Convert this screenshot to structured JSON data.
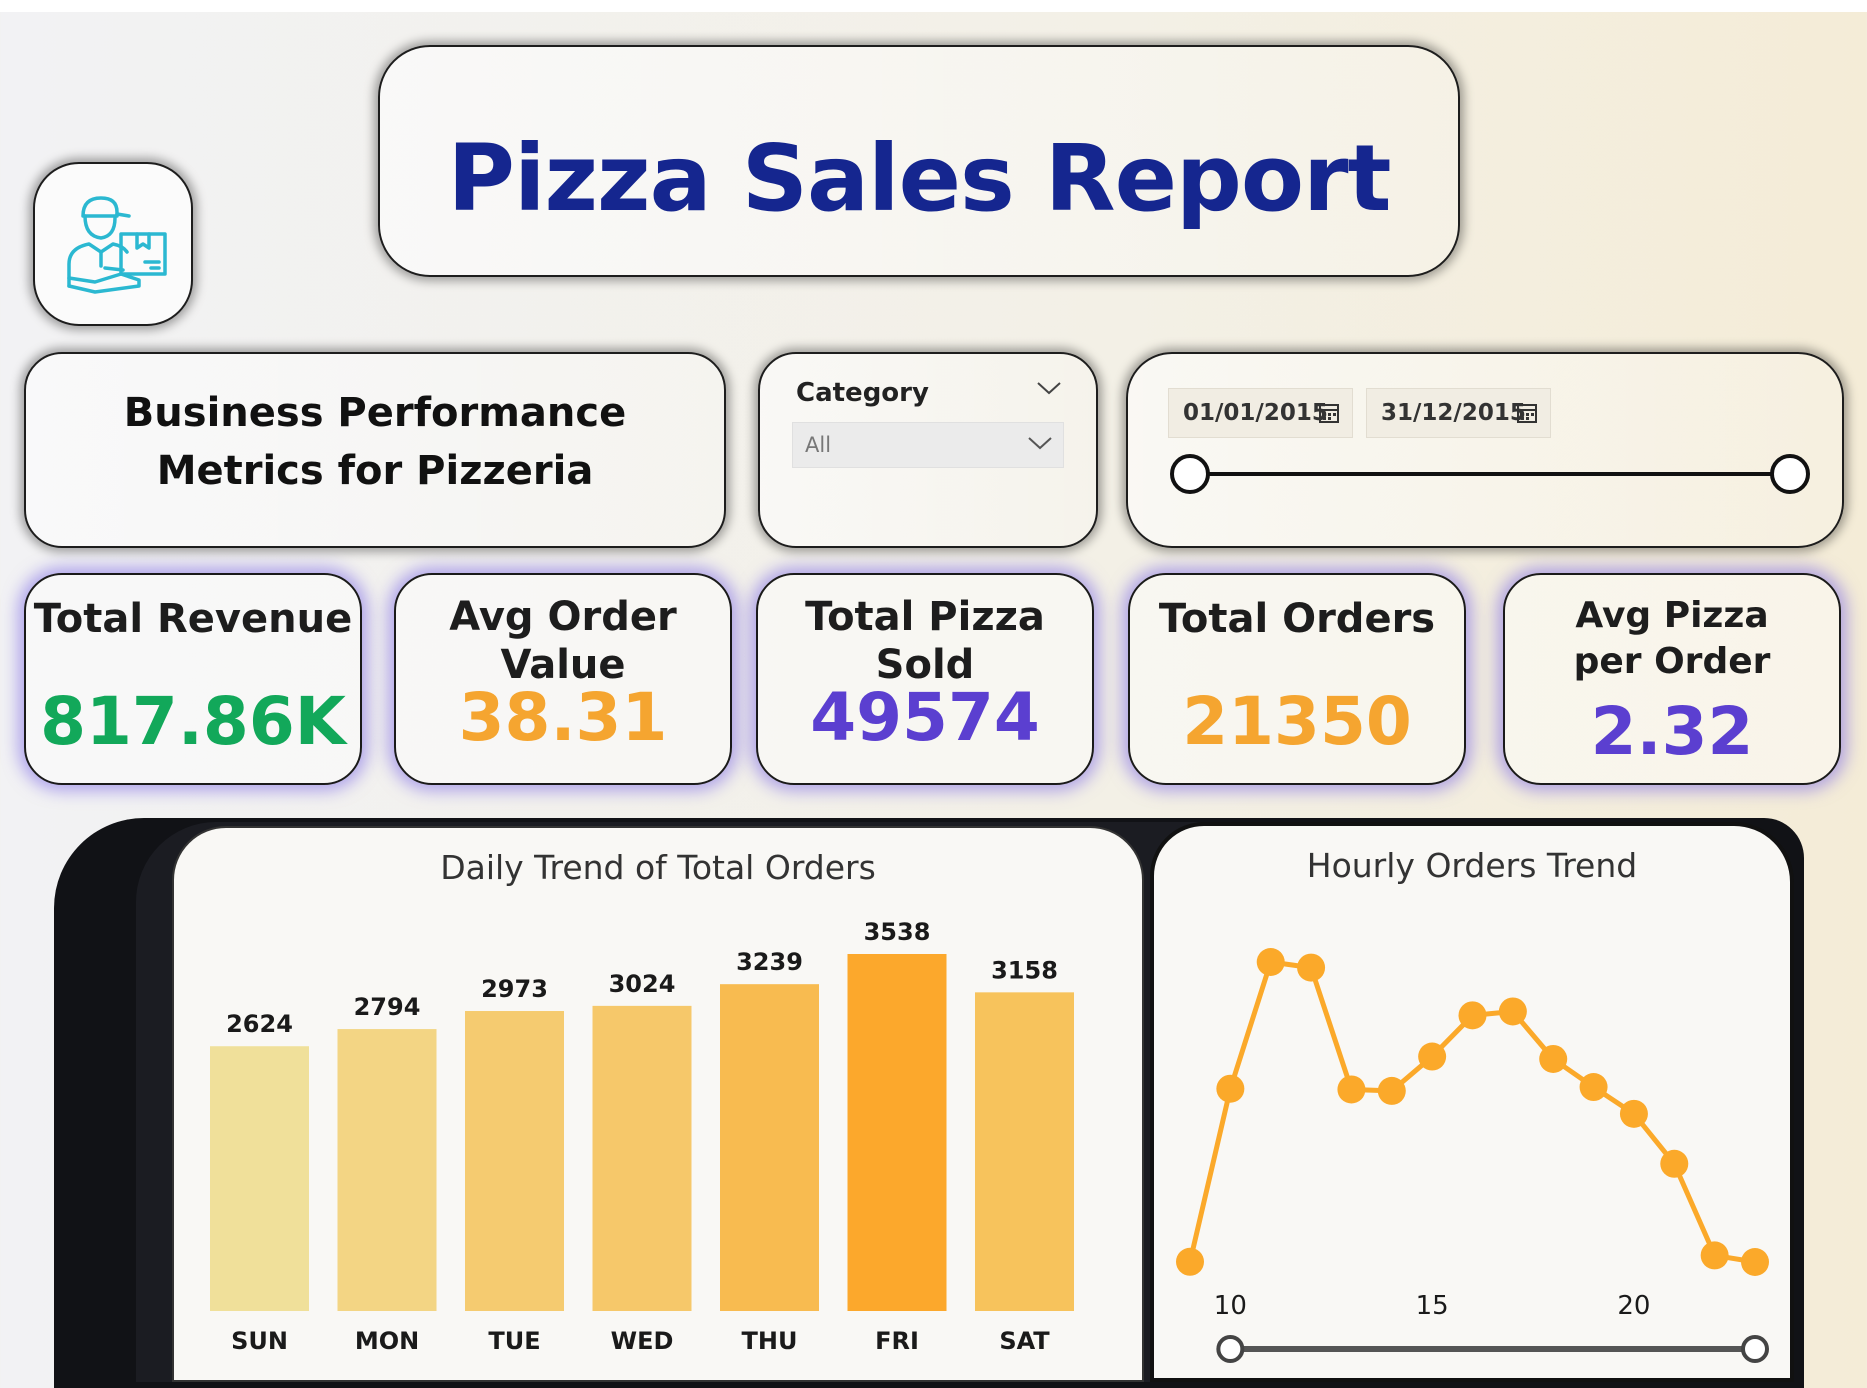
{
  "title": "Pizza Sales Report",
  "subtitle": "Business Performance Metrics for Pizzeria",
  "filters": {
    "category_label": "Category",
    "category_value": "All",
    "date_start": "01/01/2015",
    "date_end": "31/12/2015"
  },
  "kpis": [
    {
      "title": "Total Revenue",
      "value": "817.86K",
      "color": "#12a85a"
    },
    {
      "title": "Avg Order Value",
      "value": "38.31",
      "color": "#f5a530"
    },
    {
      "title": "Total Pizza Sold",
      "value": "49574",
      "color": "#5b3fd0"
    },
    {
      "title": "Total Orders",
      "value": "21350",
      "color": "#f5a530"
    },
    {
      "title": "Avg Pizza per Order",
      "value": "2.32",
      "color": "#5b3fd0"
    }
  ],
  "chart_data": [
    {
      "type": "bar",
      "title": "Daily Trend of Total Orders",
      "categories": [
        "SUN",
        "MON",
        "TUE",
        "WED",
        "THU",
        "FRI",
        "SAT"
      ],
      "values": [
        2624,
        2794,
        2973,
        3024,
        3239,
        3538,
        3158
      ],
      "colors": [
        "#f0e09a",
        "#f3d584",
        "#f5cb70",
        "#f6c86a",
        "#f8bb50",
        "#fca82c",
        "#f7c35c"
      ],
      "data_labels": true,
      "ylim": [
        0,
        3538
      ]
    },
    {
      "type": "line",
      "title": "Hourly Orders Trend",
      "x": [
        9,
        10,
        11,
        12,
        13,
        14,
        15,
        16,
        17,
        18,
        19,
        20,
        21,
        22,
        23
      ],
      "values": [
        1,
        711,
        1231,
        1208,
        708,
        702,
        843,
        1012,
        1028,
        833,
        718,
        608,
        403,
        27,
        0
      ],
      "x_ticks": [
        "10",
        "15",
        "20"
      ],
      "line_color": "#fba92a"
    }
  ]
}
